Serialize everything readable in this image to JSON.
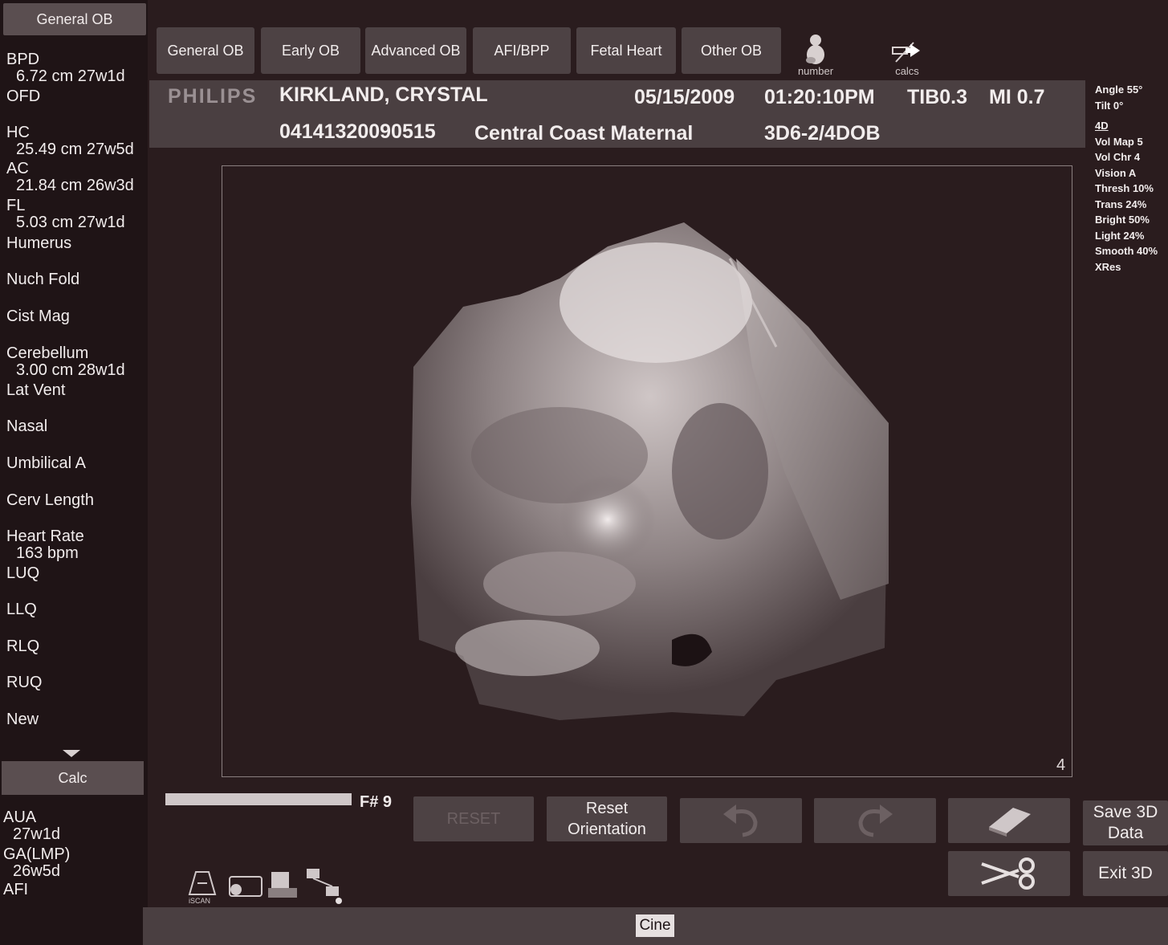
{
  "sidebar": {
    "header": "General OB",
    "items": [
      {
        "label": "BPD",
        "value": "6.72 cm 27w1d"
      },
      {
        "label": "OFD",
        "value": ""
      },
      {
        "label": "HC",
        "value": "25.49 cm 27w5d"
      },
      {
        "label": "AC",
        "value": "21.84 cm 26w3d"
      },
      {
        "label": "FL",
        "value": "5.03 cm 27w1d"
      },
      {
        "label": "Humerus",
        "value": ""
      },
      {
        "label": "Nuch Fold",
        "value": ""
      },
      {
        "label": "Cist Mag",
        "value": ""
      },
      {
        "label": "Cerebellum",
        "value": "3.00 cm 28w1d"
      },
      {
        "label": "Lat Vent",
        "value": ""
      },
      {
        "label": "Nasal",
        "value": ""
      },
      {
        "label": "Umbilical A",
        "value": ""
      },
      {
        "label": "Cerv Length",
        "value": ""
      },
      {
        "label": "Heart Rate",
        "value": "163 bpm"
      },
      {
        "label": "LUQ",
        "value": ""
      },
      {
        "label": "LLQ",
        "value": ""
      },
      {
        "label": "RLQ",
        "value": ""
      },
      {
        "label": "RUQ",
        "value": ""
      },
      {
        "label": "New",
        "value": ""
      }
    ],
    "calc_label": "Calc",
    "summary": [
      {
        "label": "AUA",
        "value": "27w1d"
      },
      {
        "label": "GA(LMP)",
        "value": "26w5d"
      },
      {
        "label": "AFI",
        "value": ""
      }
    ]
  },
  "tabs": [
    "General OB",
    "Early OB",
    "Advanced OB",
    "AFI/BPP",
    "Fetal Heart",
    "Other OB"
  ],
  "icons": {
    "number_label": "number",
    "calcs_label": "calcs"
  },
  "info": {
    "brand": "PHILIPS",
    "patient": "KIRKLAND, CRYSTAL",
    "date": "05/15/2009",
    "time": "01:20:10PM",
    "tib": "TIB0.3",
    "mi": "MI 0.7",
    "id": "04141320090515",
    "facility": "Central Coast Maternal",
    "probe": "3D6-2/4DOB"
  },
  "params": [
    "Angle 55°",
    "Tilt  0°",
    "4D",
    "Vol Map 5",
    "Vol Chr  4",
    "Vision A",
    "Thresh 10%",
    "Trans 24%",
    "Bright 50%",
    "Light 24%",
    "Smooth 40%",
    "XRes"
  ],
  "frame_number": "4",
  "controls": {
    "frame": "F#  9",
    "reset": "RESET",
    "reset_orientation": "Reset Orientation",
    "save_3d": "Save 3D Data",
    "exit_3d": "Exit 3D",
    "iscan": "iSCAN"
  },
  "status": {
    "cine": "Cine"
  }
}
